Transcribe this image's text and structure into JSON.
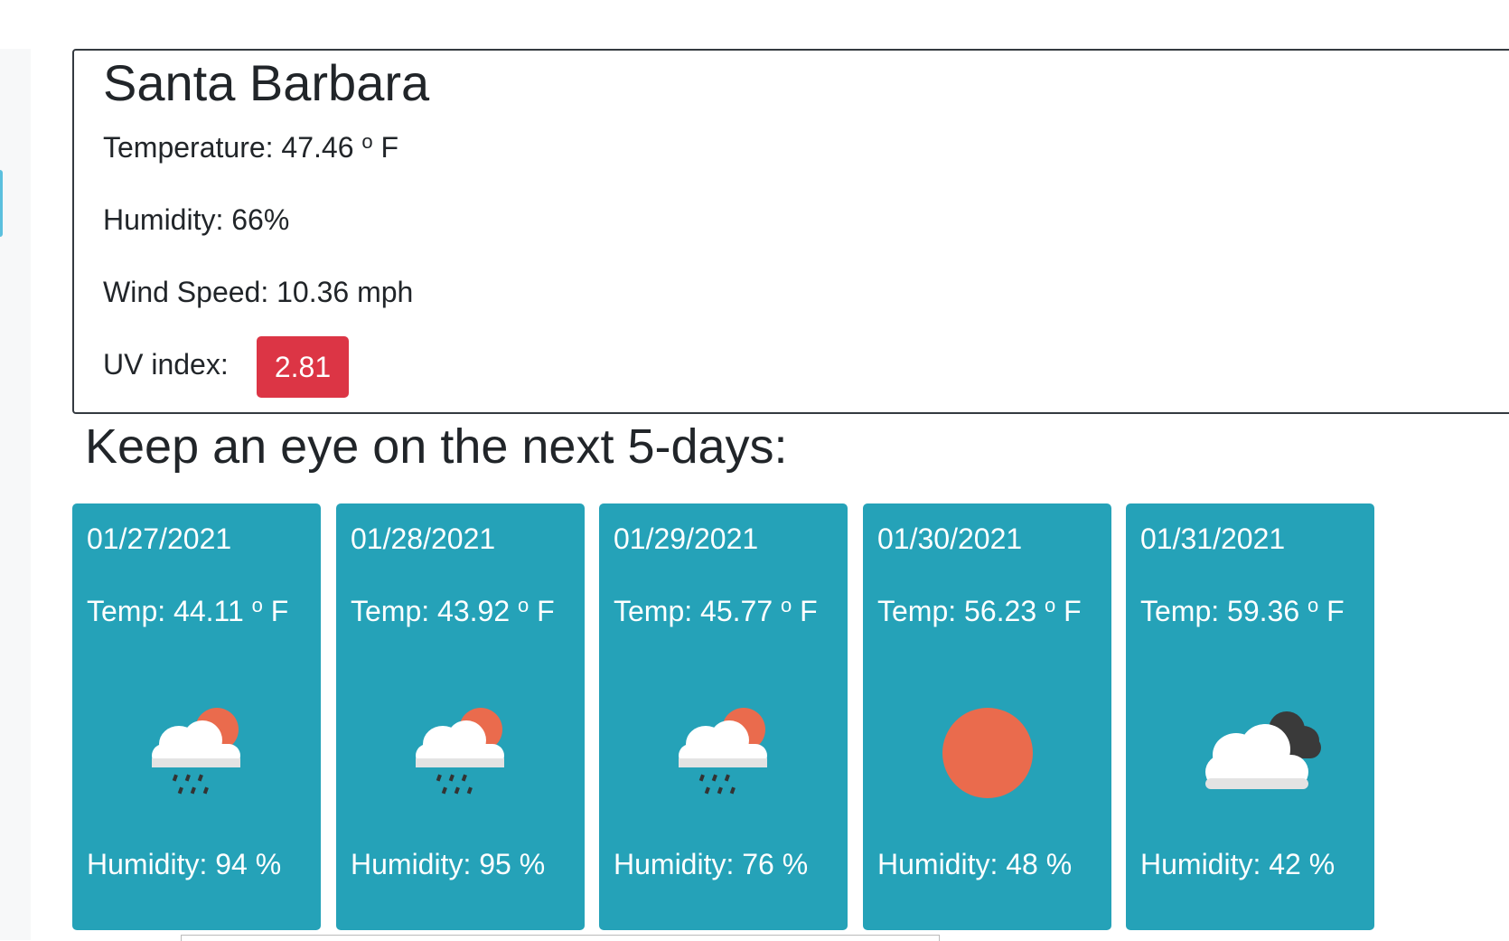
{
  "current": {
    "city": "Santa Barbara",
    "temperature_label": "Temperature:",
    "temperature_value": "47.46",
    "temperature_unit": "F",
    "degree_symbol": "o",
    "humidity": "Humidity: 66%",
    "wind": "Wind Speed: 10.36 mph",
    "uv_label": "UV index:",
    "uv_value": "2.81",
    "uv_color": "#dc3545"
  },
  "forecast": {
    "heading": "Keep an eye on the next 5-days:",
    "card_color": "#25a2b8",
    "days": [
      {
        "date": "01/27/2021",
        "temp_label": "Temp:",
        "temp": "44.11",
        "unit": "F",
        "icon": "rain-cloud-sun-icon",
        "humidity": "Humidity: 94 %"
      },
      {
        "date": "01/28/2021",
        "temp_label": "Temp:",
        "temp": "43.92",
        "unit": "F",
        "icon": "rain-cloud-sun-icon",
        "humidity": "Humidity: 95 %"
      },
      {
        "date": "01/29/2021",
        "temp_label": "Temp:",
        "temp": "45.77",
        "unit": "F",
        "icon": "rain-cloud-sun-icon",
        "humidity": "Humidity: 76 %"
      },
      {
        "date": "01/30/2021",
        "temp_label": "Temp:",
        "temp": "56.23",
        "unit": "F",
        "icon": "sun-icon",
        "humidity": "Humidity: 48 %"
      },
      {
        "date": "01/31/2021",
        "temp_label": "Temp:",
        "temp": "59.36",
        "unit": "F",
        "icon": "broken-clouds-icon",
        "humidity": "Humidity: 42 %"
      }
    ]
  }
}
